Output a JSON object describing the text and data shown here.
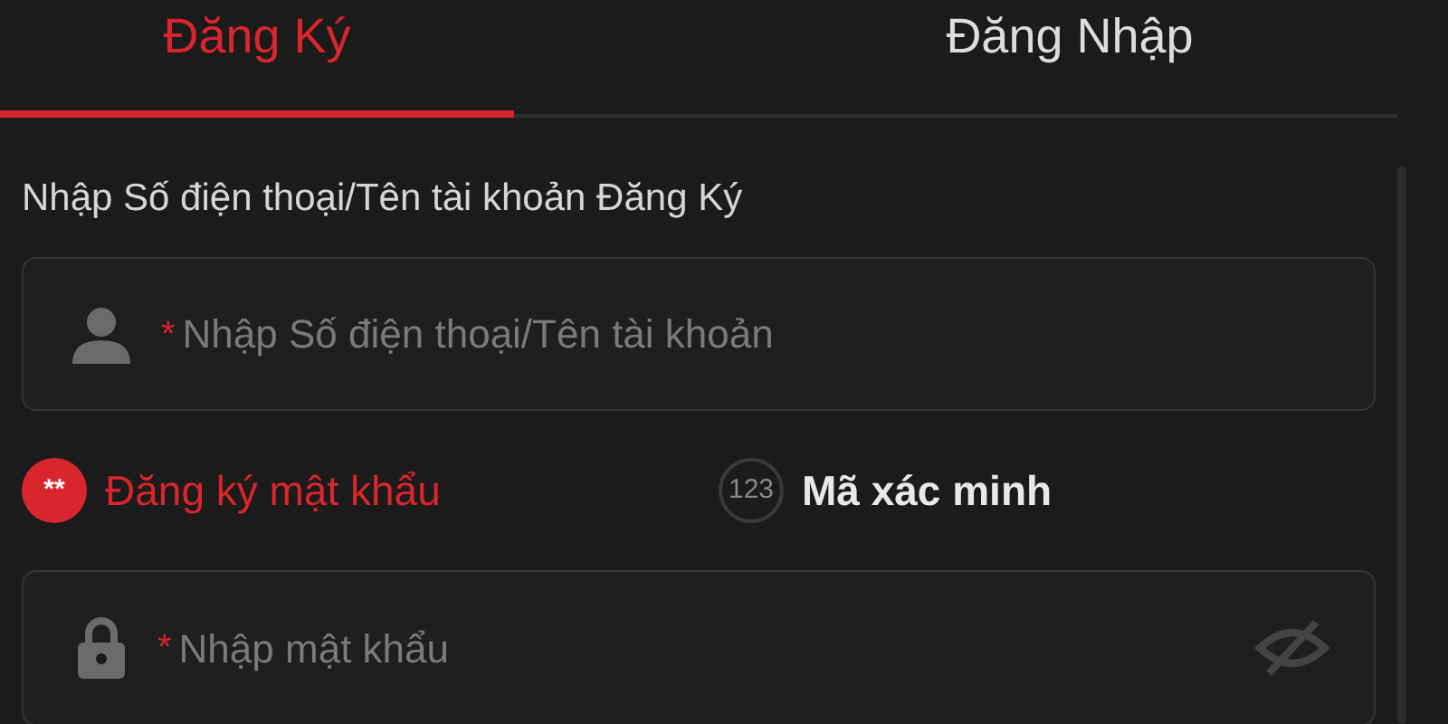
{
  "tabs": [
    {
      "label": "Đăng Ký",
      "selected": true
    },
    {
      "label": "Đăng Nhập",
      "selected": false
    }
  ],
  "account": {
    "label": "Nhập Số điện thoại/Tên tài khoản Đăng Ký",
    "required_mark": "*",
    "placeholder": "Nhập Số điện thoại/Tên tài khoản"
  },
  "methods": [
    {
      "badge": "**",
      "label": "Đăng ký mật khẩu",
      "selected": true
    },
    {
      "badge": "123",
      "label": "Mã xác minh",
      "selected": false
    }
  ],
  "password": {
    "required_mark": "*",
    "placeholder": "Nhập mật khẩu"
  }
}
